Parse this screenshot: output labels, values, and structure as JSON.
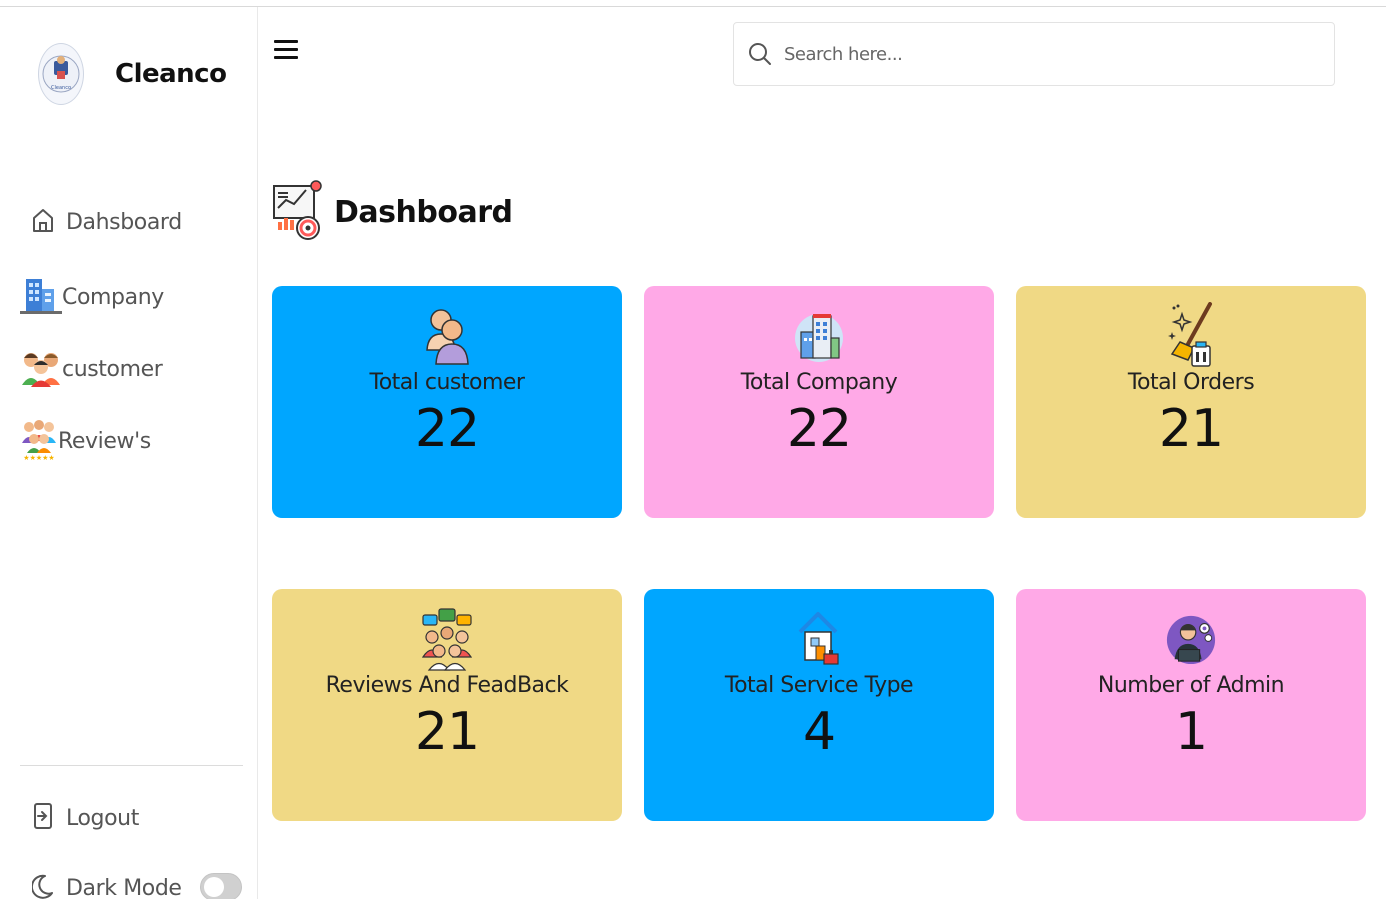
{
  "app": {
    "brand_name": "Cleanco",
    "logo_text": "Cleanco"
  },
  "sidebar": {
    "items": [
      {
        "label": "Dahsboard",
        "icon": "home-icon"
      },
      {
        "label": "Company",
        "icon": "company-building-icon"
      },
      {
        "label": "customer",
        "icon": "customers-group-icon"
      },
      {
        "label": "Review's",
        "icon": "reviews-people-icon"
      }
    ],
    "logout_label": "Logout",
    "dark_mode_label": "Dark Mode",
    "dark_mode_on": false
  },
  "header": {
    "search_placeholder": "Search here..."
  },
  "page": {
    "title": "Dashboard"
  },
  "colors": {
    "blue": "#00a6ff",
    "pink": "#ffa9e7",
    "yellow": "#f0d985"
  },
  "stats": [
    {
      "label": "Total customer",
      "value": "22",
      "color": "#00a6ff",
      "icon": "customer-icon"
    },
    {
      "label": "Total Company",
      "value": "22",
      "color": "#ffa9e7",
      "icon": "company-icon"
    },
    {
      "label": "Total Orders",
      "value": "21",
      "color": "#f0d985",
      "icon": "cleaning-broom-icon"
    },
    {
      "label": "Reviews And FeadBack",
      "value": "21",
      "color": "#f0d985",
      "icon": "feedback-people-icon"
    },
    {
      "label": "Total Service Type",
      "value": "4",
      "color": "#00a6ff",
      "icon": "house-service-icon"
    },
    {
      "label": "Number of Admin",
      "value": "1",
      "color": "#ffa9e7",
      "icon": "admin-avatar-icon"
    }
  ]
}
